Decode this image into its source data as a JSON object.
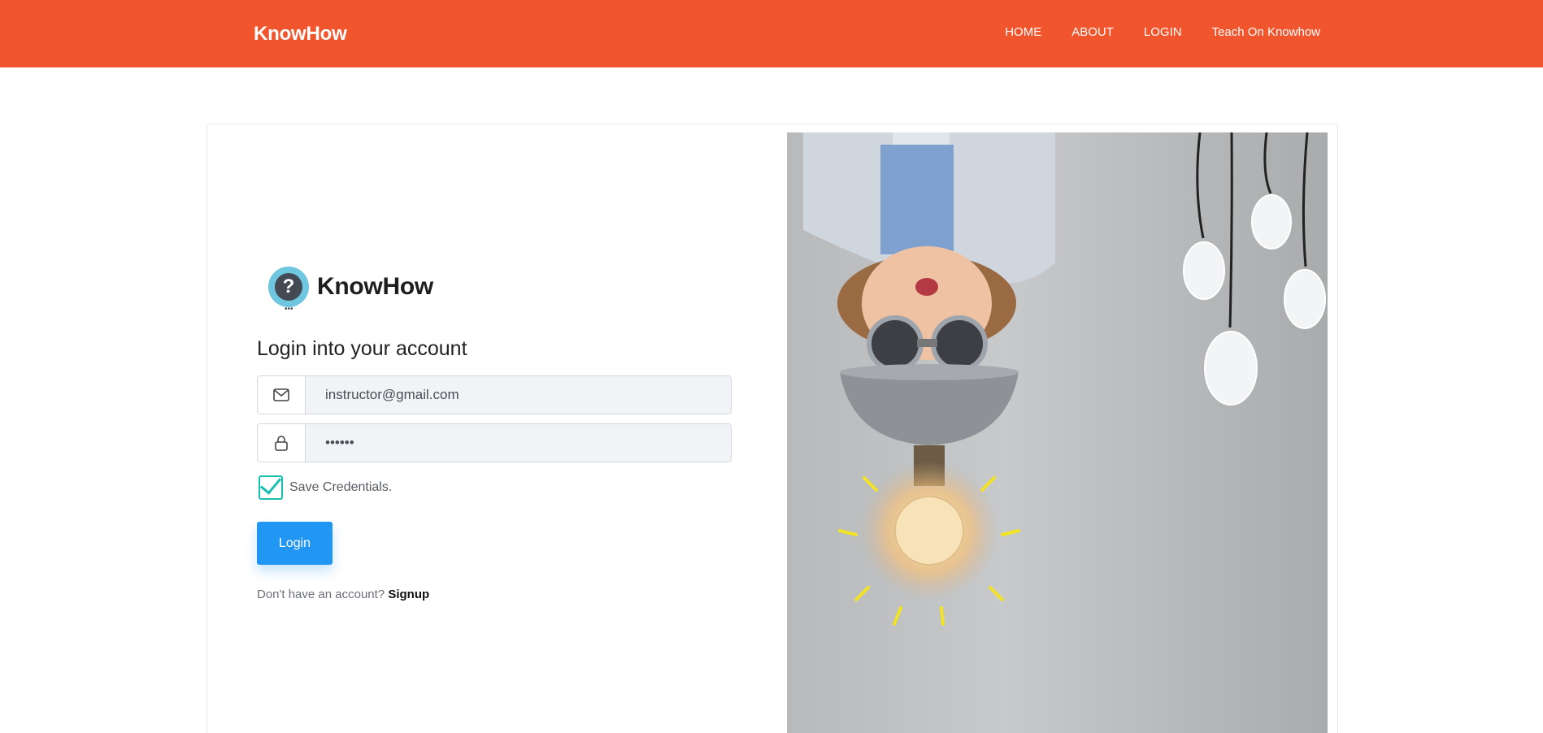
{
  "navbar": {
    "brand": "KnowHow",
    "links": [
      "HOME",
      "ABOUT",
      "LOGIN",
      "Teach On Knowhow"
    ],
    "background": "#f1552d"
  },
  "login": {
    "logo_text": "KnowHow",
    "logo_symbol": "?",
    "heading": "Login into your account",
    "email": {
      "icon": "envelope-icon",
      "value": "instructor@gmail.com"
    },
    "password": {
      "icon": "lock-icon",
      "value": "••••••"
    },
    "remember": {
      "label": "Save Credentials.",
      "checked": true,
      "accent": "#19c0b0"
    },
    "submit_label": "Login",
    "submit_color": "#2196f3",
    "signup_prompt": "Don't have an account?",
    "signup_link": "Signup"
  },
  "hero_image": {
    "icon": "hero-illustration"
  }
}
